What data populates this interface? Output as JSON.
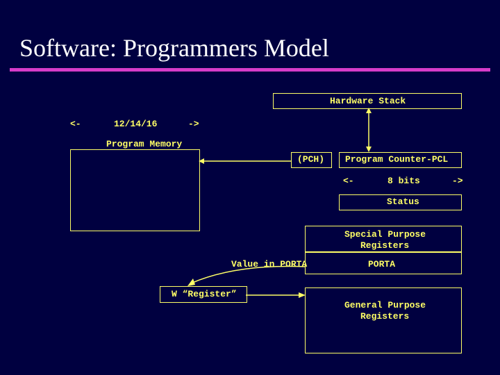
{
  "title": "Software: Programmers Model",
  "hardware_stack_label": "Hardware Stack",
  "width_row": {
    "left": "<-",
    "value": "12/14/16",
    "right": "->"
  },
  "program_memory_label": "Program Memory",
  "pch_label": "(PCH)",
  "pc_pcl_label": "Program Counter-PCL",
  "bits_row": {
    "left": "<-",
    "value": "8 bits",
    "right": "->"
  },
  "status_label": "Status",
  "spr_label_line1": "Special Purpose",
  "spr_label_line2": "Registers",
  "value_in_porta_label": "Value in PORTA",
  "porta_label": "PORTA",
  "w_register_label": "W “Register”",
  "gpr_label_line1": "General Purpose",
  "gpr_label_line2": "Registers"
}
